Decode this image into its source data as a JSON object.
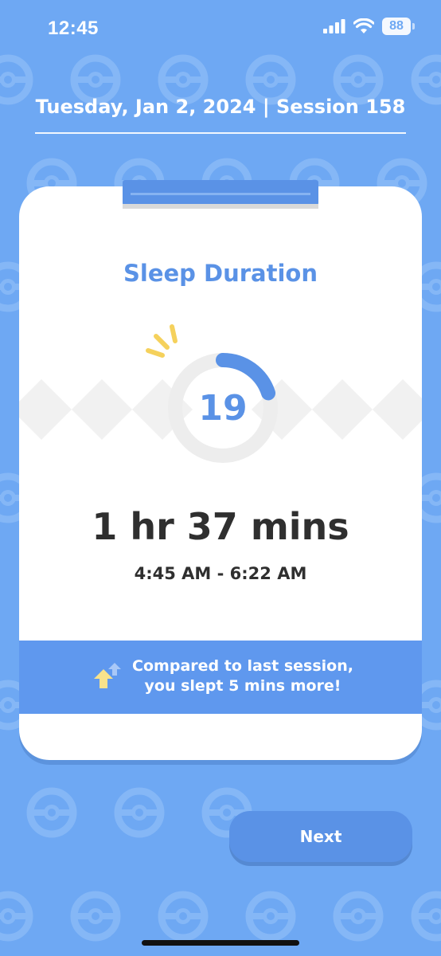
{
  "status_bar": {
    "time": "12:45",
    "battery": "88",
    "icons": [
      "signal-icon",
      "wifi-icon",
      "battery-icon"
    ]
  },
  "header": {
    "date_session": "Tuesday, Jan 2, 2024 | Session 158"
  },
  "card": {
    "title": "Sleep Duration",
    "score": "19",
    "score_ring_fraction": 0.2,
    "duration": "1 hr 37 mins",
    "time_range": "4:45 AM - 6:22 AM",
    "comparison": {
      "line1": "Compared to last session,",
      "line2": "you slept 5 mins more!",
      "icon": "up-arrows-icon"
    }
  },
  "actions": {
    "next_label": "Next"
  },
  "colors": {
    "background": "#6ea8f3",
    "accent": "#5a92e6",
    "band": "#5f98ee",
    "sparkle": "#f5d15c"
  }
}
